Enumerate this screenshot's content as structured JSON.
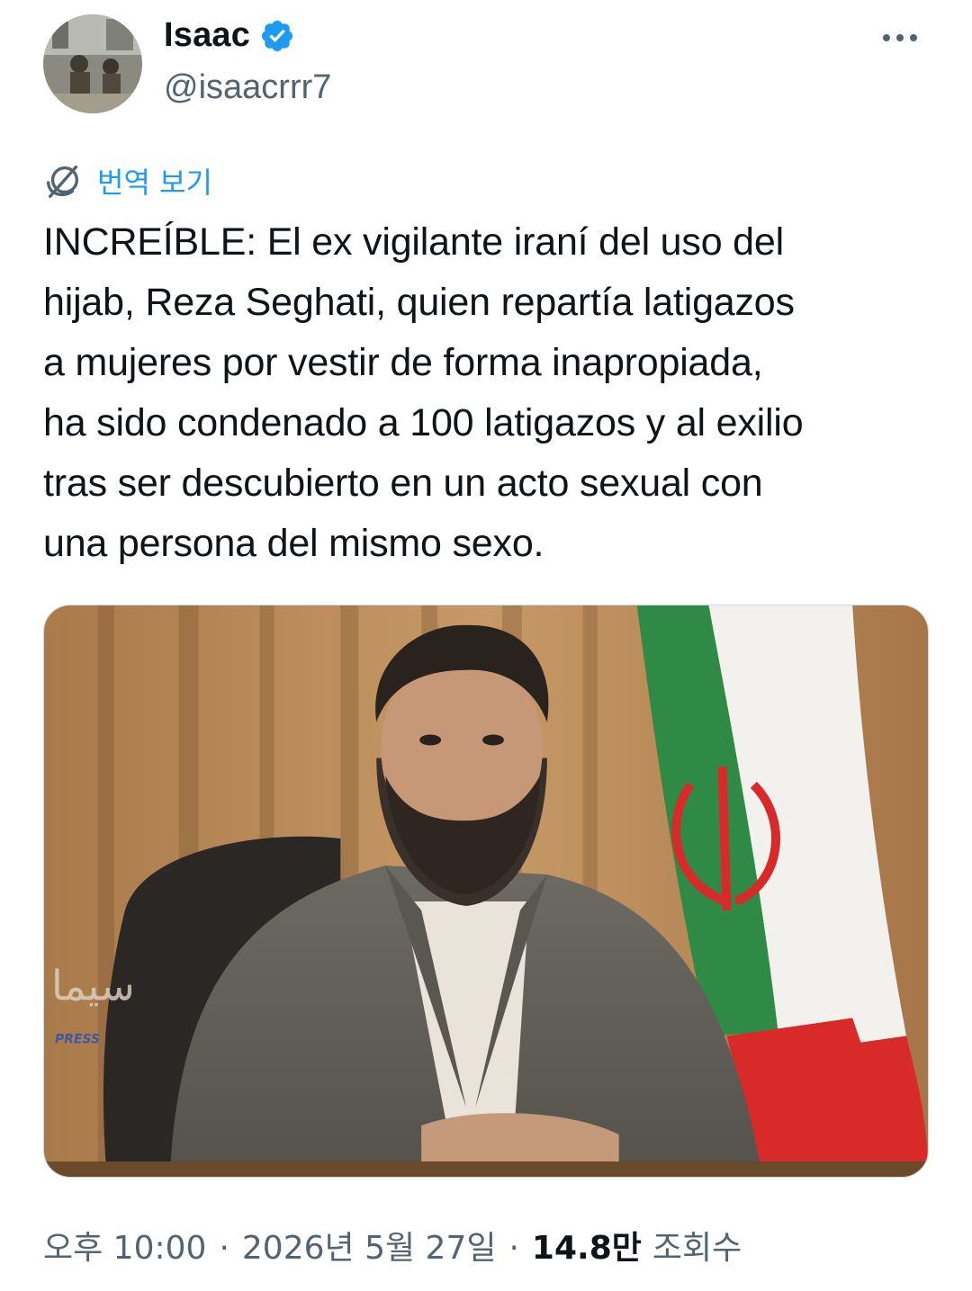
{
  "author": {
    "display_name": "Isaac",
    "handle": "@isaacrrr7",
    "verified": true,
    "avatar_icon": "avatar-photo-icon"
  },
  "translate": {
    "label": "번역 보기",
    "icon": "translate-globe-icon"
  },
  "tweet": {
    "text": "INCREÍBLE: El ex vigilante iraní del uso del\nhijab, Reza Seghati, quien repartía latigazos\na mujeres por vestir de forma inapropiada,\nha sido condenado a 100 latigazos y al exilio\ntras ser descubierto en un acto sexual con\nuna persona del mismo sexo."
  },
  "media": {
    "watermark": "PRESS"
  },
  "meta": {
    "time": "오후 10:00",
    "separator": "·",
    "date": "2026년 5월 27일",
    "views_count": "14.8만",
    "views_label": "조회수"
  },
  "colors": {
    "accent": "#1d9bf0",
    "secondary_text": "#536471",
    "primary_text": "#0f1419"
  }
}
